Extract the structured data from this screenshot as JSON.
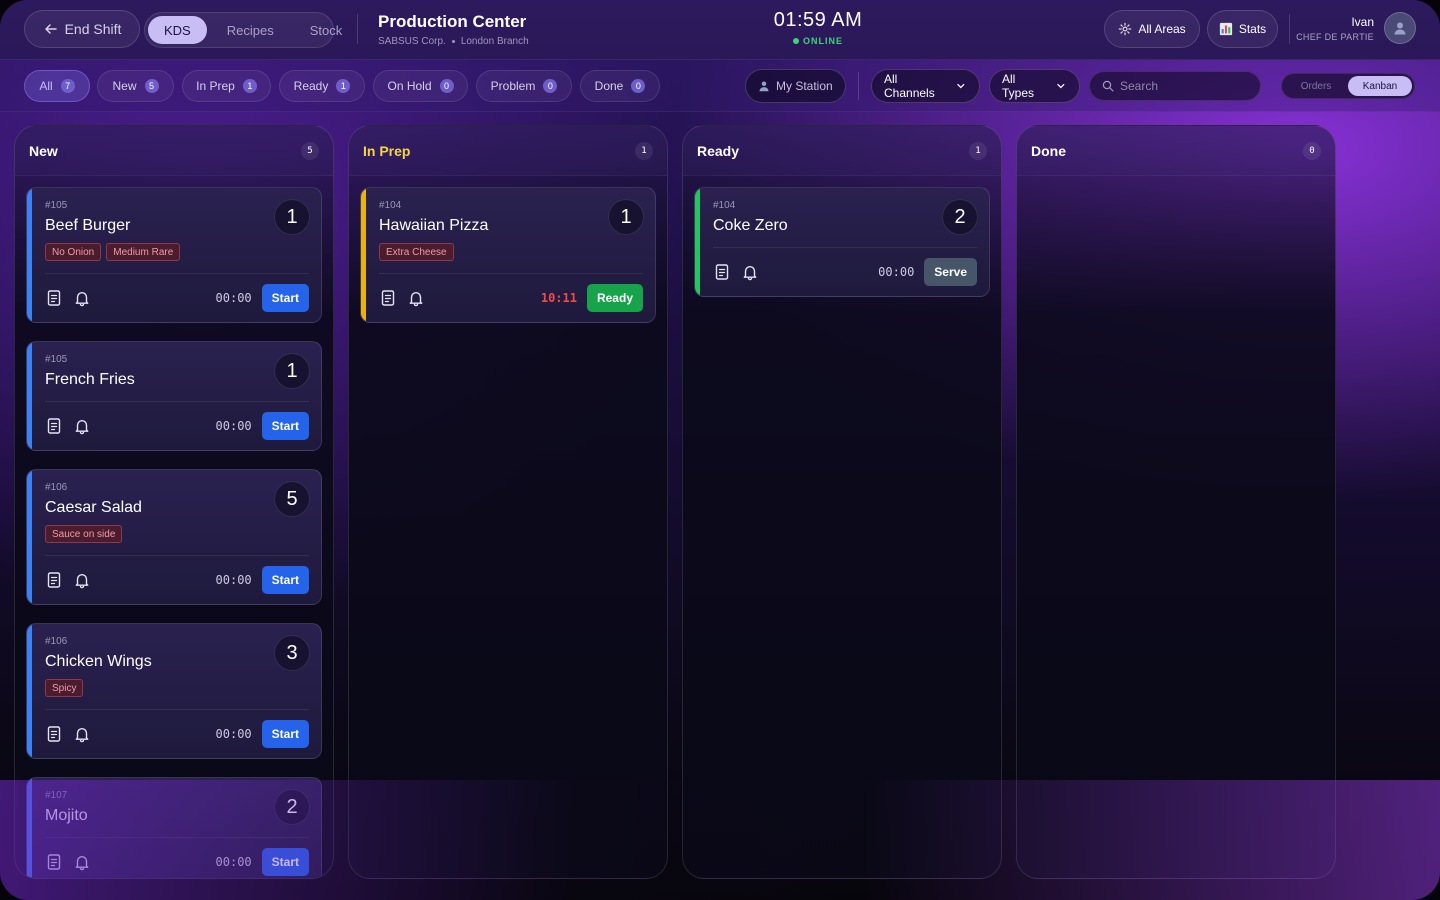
{
  "colors": {
    "accent": "#c9bdf5",
    "start": "#2563eb",
    "ready": "#16a34a",
    "serve": "#475569",
    "new_stripe": "#3b82f6",
    "prep_stripe": "#eab308",
    "ready_stripe": "#22c55e",
    "online": "#3ed37a",
    "late_timer": "#f04b4b"
  },
  "header": {
    "end_shift_label": "End Shift",
    "modes": [
      {
        "label": "KDS",
        "active": true
      },
      {
        "label": "Recipes",
        "active": false
      },
      {
        "label": "Stock",
        "active": false
      }
    ],
    "title": "Production Center",
    "company": "SABSUS Corp.",
    "branch": "London Branch",
    "time": "01:59 AM",
    "status": "ONLINE",
    "areas_label": "All Areas",
    "areas_icon": "gear-icon",
    "stats_label": "Stats",
    "stats_icon": "bar-chart-icon",
    "user_name": "Ivan",
    "user_role": "CHEF DE PARTIE"
  },
  "filters": {
    "chips": [
      {
        "label": "All",
        "count": "7",
        "active": true
      },
      {
        "label": "New",
        "count": "5",
        "active": false
      },
      {
        "label": "In Prep",
        "count": "1",
        "active": false
      },
      {
        "label": "Ready",
        "count": "1",
        "active": false
      },
      {
        "label": "On Hold",
        "count": "0",
        "active": false
      },
      {
        "label": "Problem",
        "count": "0",
        "active": false
      },
      {
        "label": "Done",
        "count": "0",
        "active": false
      }
    ],
    "my_station": "My Station",
    "channels": "All Channels",
    "types": "All Types",
    "search_placeholder": "Search",
    "views": [
      {
        "label": "Orders",
        "active": false
      },
      {
        "label": "Kanban",
        "active": true
      }
    ]
  },
  "columns": [
    {
      "key": "new",
      "title": "New",
      "count": "5",
      "title_color": "#ffffff",
      "stripe": "#3b82f6",
      "cards": [
        {
          "order": "#105",
          "name": "Beef Burger",
          "qty": "1",
          "mods": [
            "No Onion",
            "Medium Rare"
          ],
          "timer": "00:00",
          "action": "Start",
          "action_color": "#2563eb",
          "late": false
        },
        {
          "order": "#105",
          "name": "French Fries",
          "qty": "1",
          "mods": [],
          "timer": "00:00",
          "action": "Start",
          "action_color": "#2563eb",
          "late": false
        },
        {
          "order": "#106",
          "name": "Caesar Salad",
          "qty": "5",
          "mods": [
            "Sauce on side"
          ],
          "timer": "00:00",
          "action": "Start",
          "action_color": "#2563eb",
          "late": false
        },
        {
          "order": "#106",
          "name": "Chicken Wings",
          "qty": "3",
          "mods": [
            "Spicy"
          ],
          "timer": "00:00",
          "action": "Start",
          "action_color": "#2563eb",
          "late": false
        },
        {
          "order": "#107",
          "name": "Mojito",
          "qty": "2",
          "mods": [],
          "timer": "00:00",
          "action": "Start",
          "action_color": "#2563eb",
          "late": false
        }
      ]
    },
    {
      "key": "in-prep",
      "title": "In Prep",
      "count": "1",
      "title_color": "#f5d442",
      "stripe": "#eab308",
      "cards": [
        {
          "order": "#104",
          "name": "Hawaiian Pizza",
          "qty": "1",
          "mods": [
            "Extra Cheese"
          ],
          "timer": "10:11",
          "action": "Ready",
          "action_color": "#16a34a",
          "late": true
        }
      ]
    },
    {
      "key": "ready",
      "title": "Ready",
      "count": "1",
      "title_color": "#ffffff",
      "stripe": "#22c55e",
      "cards": [
        {
          "order": "#104",
          "name": "Coke Zero",
          "qty": "2",
          "mods": [],
          "timer": "00:00",
          "action": "Serve",
          "action_color": "#475569",
          "late": false
        }
      ]
    },
    {
      "key": "done",
      "title": "Done",
      "count": "0",
      "title_color": "#ffffff",
      "stripe": "#64748b",
      "cards": []
    }
  ]
}
